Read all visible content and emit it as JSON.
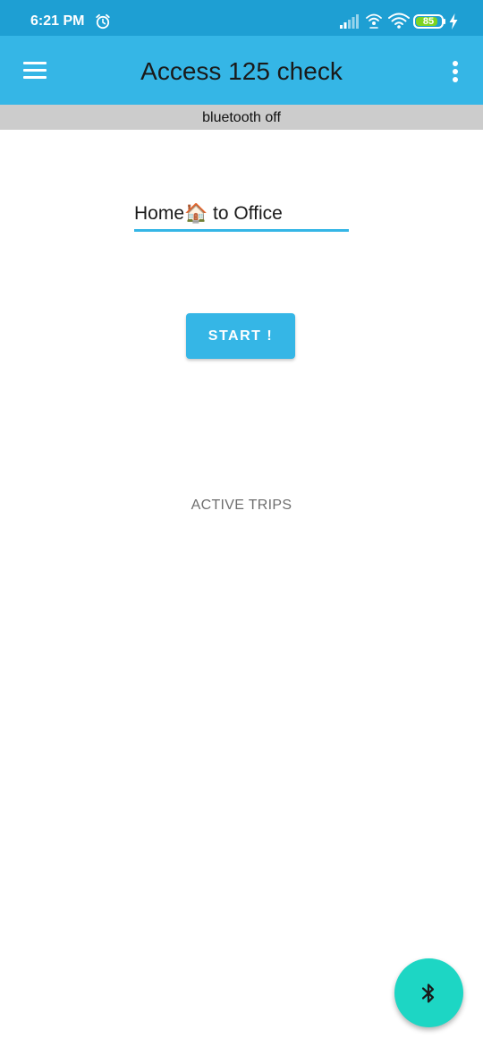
{
  "status_bar": {
    "time": "6:21 PM",
    "battery_level": "85",
    "battery_fraction": 0.85,
    "icons": [
      "alarm-icon",
      "cell-signal-icon",
      "hotspot-icon",
      "wifi-icon",
      "battery-icon",
      "charging-icon"
    ]
  },
  "app_bar": {
    "title": "Access 125 check",
    "menu_icon": "hamburger-menu-icon",
    "overflow_icon": "more-vert-icon"
  },
  "bluetooth_banner": {
    "text": "bluetooth off"
  },
  "trip": {
    "input_value": "Home🏠 to Office"
  },
  "start_button": {
    "label": "START !"
  },
  "active_trips": {
    "label": "ACTIVE TRIPS"
  },
  "fab": {
    "icon": "bluetooth-icon"
  },
  "colors": {
    "status_bar": "#1e9fd3",
    "app_bar": "#35b6e6",
    "banner": "#cccccc",
    "accent": "#35b6e6",
    "fab": "#1dd6c4",
    "battery_fill": "#7ed321"
  }
}
